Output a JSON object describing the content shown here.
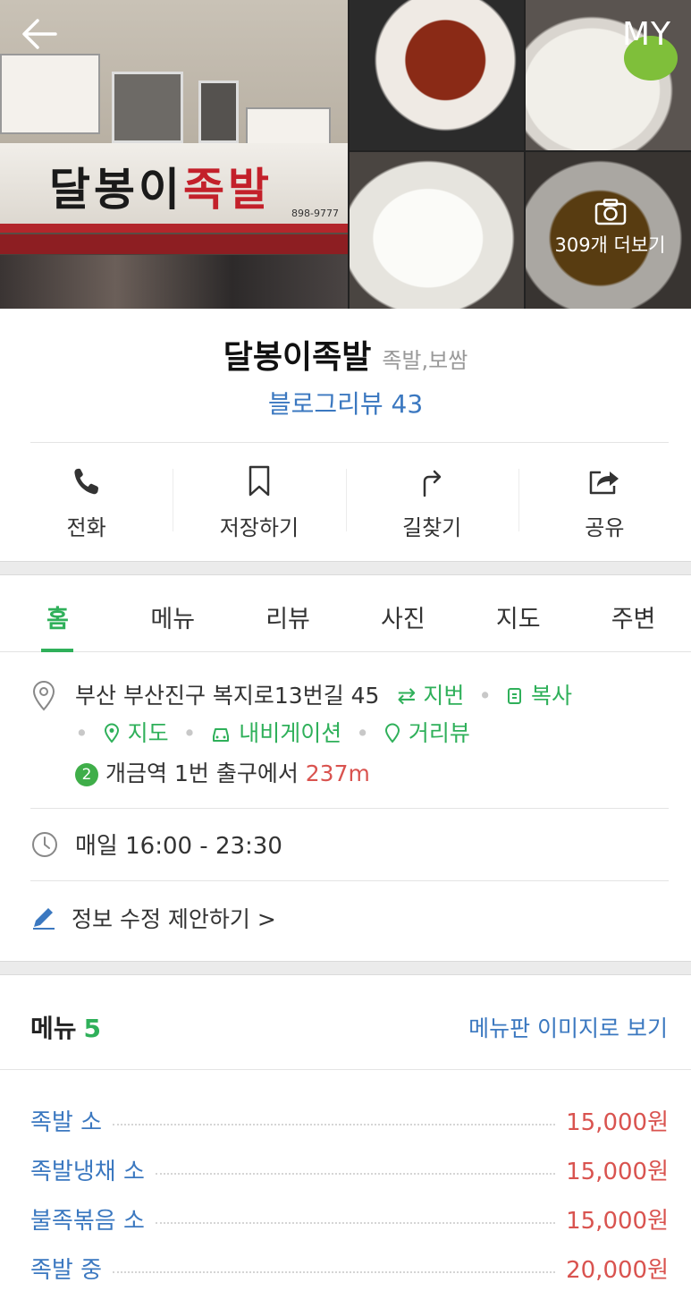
{
  "header": {
    "back_icon": "back-arrow-icon",
    "my_label": "MY",
    "more_photos_label": "309개 더보기",
    "camera_icon": "camera-icon",
    "storefront": {
      "sign_main": "달봉이",
      "sign_red": "족발",
      "sign_phone": "898-9777"
    }
  },
  "place": {
    "name": "달봉이족발",
    "category": "족발,보쌈",
    "blog_review": "블로그리뷰 43"
  },
  "actions": [
    {
      "label": "전화",
      "icon": "phone-icon"
    },
    {
      "label": "저장하기",
      "icon": "bookmark-icon"
    },
    {
      "label": "길찾기",
      "icon": "directions-icon"
    },
    {
      "label": "공유",
      "icon": "share-icon"
    }
  ],
  "tabs": [
    "홈",
    "메뉴",
    "리뷰",
    "사진",
    "지도",
    "주변"
  ],
  "active_tab": "홈",
  "info": {
    "address": "부산 부산진구 복지로13번길 45",
    "jibun": "지번",
    "copy": "복사",
    "map": "지도",
    "navigation": "내비게이션",
    "street_view": "거리뷰",
    "subway_line": "2",
    "station": "개금역",
    "exit": "1번 출구에서",
    "distance": "237m",
    "hours": "매일 16:00 - 23:30",
    "suggest_edit": "정보 수정 제안하기"
  },
  "menu": {
    "title": "메뉴",
    "count": "5",
    "image_link": "메뉴판 이미지로 보기",
    "items": [
      {
        "name": "족발 소",
        "price": "15,000원"
      },
      {
        "name": "족발냉채 소",
        "price": "15,000원"
      },
      {
        "name": "불족볶음 소",
        "price": "15,000원"
      },
      {
        "name": "족발 중",
        "price": "20,000원"
      }
    ]
  },
  "colors": {
    "accent_green": "#2fb05a",
    "link_blue": "#3b78c0",
    "price_red": "#d9534f"
  }
}
